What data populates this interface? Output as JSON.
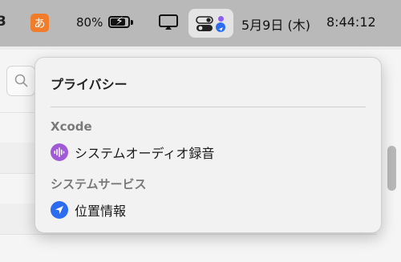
{
  "menubar": {
    "partial_left_glyph": "3",
    "input_method_label": "あ",
    "battery_percent_label": "80%",
    "battery_level": 0.8,
    "date": "5月9日 (木)",
    "time": "8:44:12",
    "icons": {
      "input_method": "hiragana-input-icon",
      "battery": "battery-charging-icon",
      "display": "display-icon",
      "control_center": "control-center-icon"
    },
    "colors": {
      "input_method": "#f17c2a",
      "indicator_purple": "#8f5cf0",
      "indicator_blue": "#2b6cf0"
    }
  },
  "privacy_popover": {
    "title": "プライバシー",
    "sections": [
      {
        "title": "Xcode",
        "items": [
          {
            "label": "システムオーディオ録音",
            "icon": "waveform-icon",
            "color": "#a05ad8"
          }
        ]
      },
      {
        "title": "システムサービス",
        "items": [
          {
            "label": "位置情報",
            "icon": "location-arrow-icon",
            "color": "#2b6cf0"
          }
        ]
      }
    ]
  }
}
